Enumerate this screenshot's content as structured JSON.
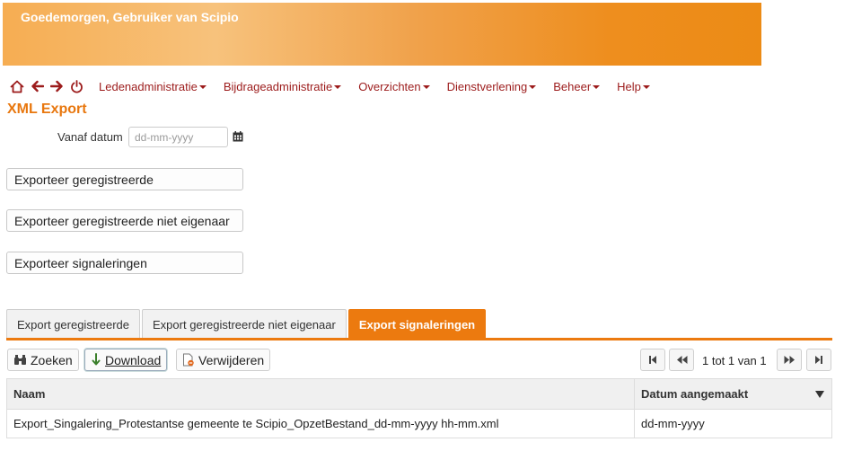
{
  "header": {
    "greeting": "Goedemorgen, Gebruiker van Scipio"
  },
  "nav": {
    "icons": [
      "home-icon",
      "arrow-left-icon",
      "arrow-right-icon",
      "power-icon"
    ],
    "menu": [
      {
        "label": "Ledenadministratie"
      },
      {
        "label": "Bijdrageadministratie"
      },
      {
        "label": "Overzichten"
      },
      {
        "label": "Dienstverlening"
      },
      {
        "label": "Beheer"
      },
      {
        "label": "Help"
      }
    ]
  },
  "page": {
    "title": "XML Export"
  },
  "filter": {
    "date_label": "Vanaf datum",
    "date_placeholder": "dd-mm-yyyy"
  },
  "actions": {
    "export_registered": "Exporteer geregistreerde",
    "export_registered_not_owner": "Exporteer geregistreerde niet eigenaar",
    "export_signals": "Exporteer signaleringen"
  },
  "tabs": [
    {
      "label": "Export geregistreerde",
      "active": false
    },
    {
      "label": "Export geregistreerde niet eigenaar",
      "active": false
    },
    {
      "label": "Export signaleringen",
      "active": true
    }
  ],
  "toolbar": {
    "search": "Zoeken",
    "download": "Download",
    "delete": "Verwijderen"
  },
  "pager": {
    "info": "1 tot 1 van 1"
  },
  "grid": {
    "columns": [
      "Naam",
      "Datum aangemaakt"
    ],
    "rows": [
      {
        "name": "Export_Singalering_Protestantse gemeente te Scipio_OpzetBestand_dd-mm-yyyy hh-mm.xml",
        "date": "dd-mm-yyyy"
      }
    ]
  },
  "colors": {
    "accent": "#ec7a0f",
    "nav_red": "#9c1b1b"
  }
}
